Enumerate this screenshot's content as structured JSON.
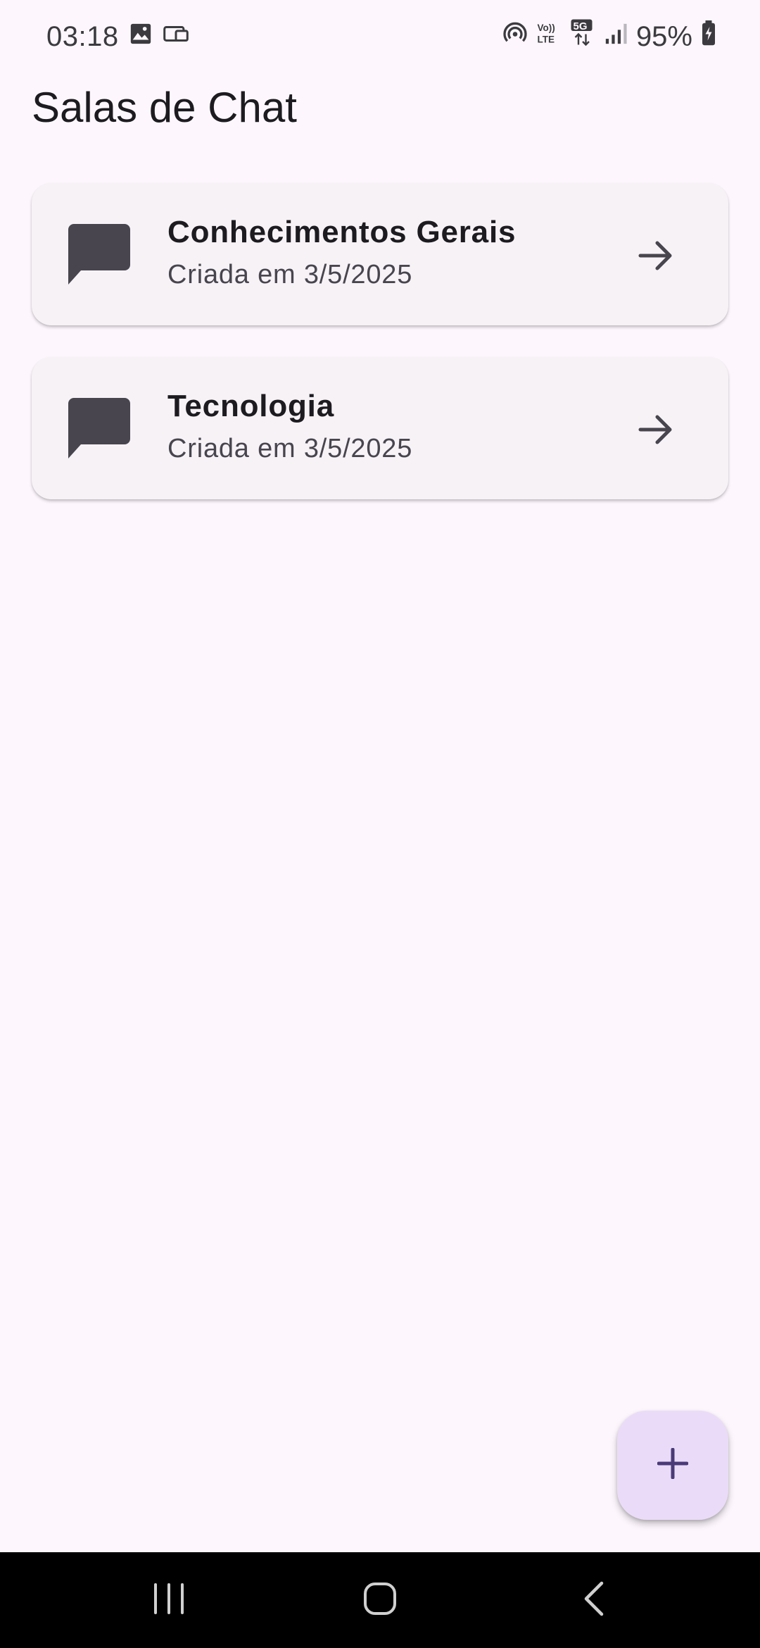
{
  "status_bar": {
    "time": "03:18",
    "battery": "95%",
    "icons": [
      "gallery-icon",
      "cast-icon",
      "hotspot-icon",
      "volte-icon",
      "5g-icon",
      "signal-icon",
      "battery-icon"
    ]
  },
  "header": {
    "title": "Salas de Chat"
  },
  "rooms": [
    {
      "name": "Conhecimentos Gerais",
      "date": "Criada em 3/5/2025",
      "icon": "chat-bubble-icon"
    },
    {
      "name": "Tecnologia",
      "date": "Criada em 3/5/2025",
      "icon": "chat-bubble-icon"
    }
  ],
  "fab": {
    "icon": "plus-icon"
  },
  "nav_bar": {
    "buttons": [
      "recents-icon",
      "home-icon",
      "back-icon"
    ]
  },
  "colors": {
    "background": "#fdf7fd",
    "card": "#f6f2f6",
    "fab": "#eadcf8",
    "fab_icon": "#4a3a78",
    "icon": "#49454f"
  }
}
